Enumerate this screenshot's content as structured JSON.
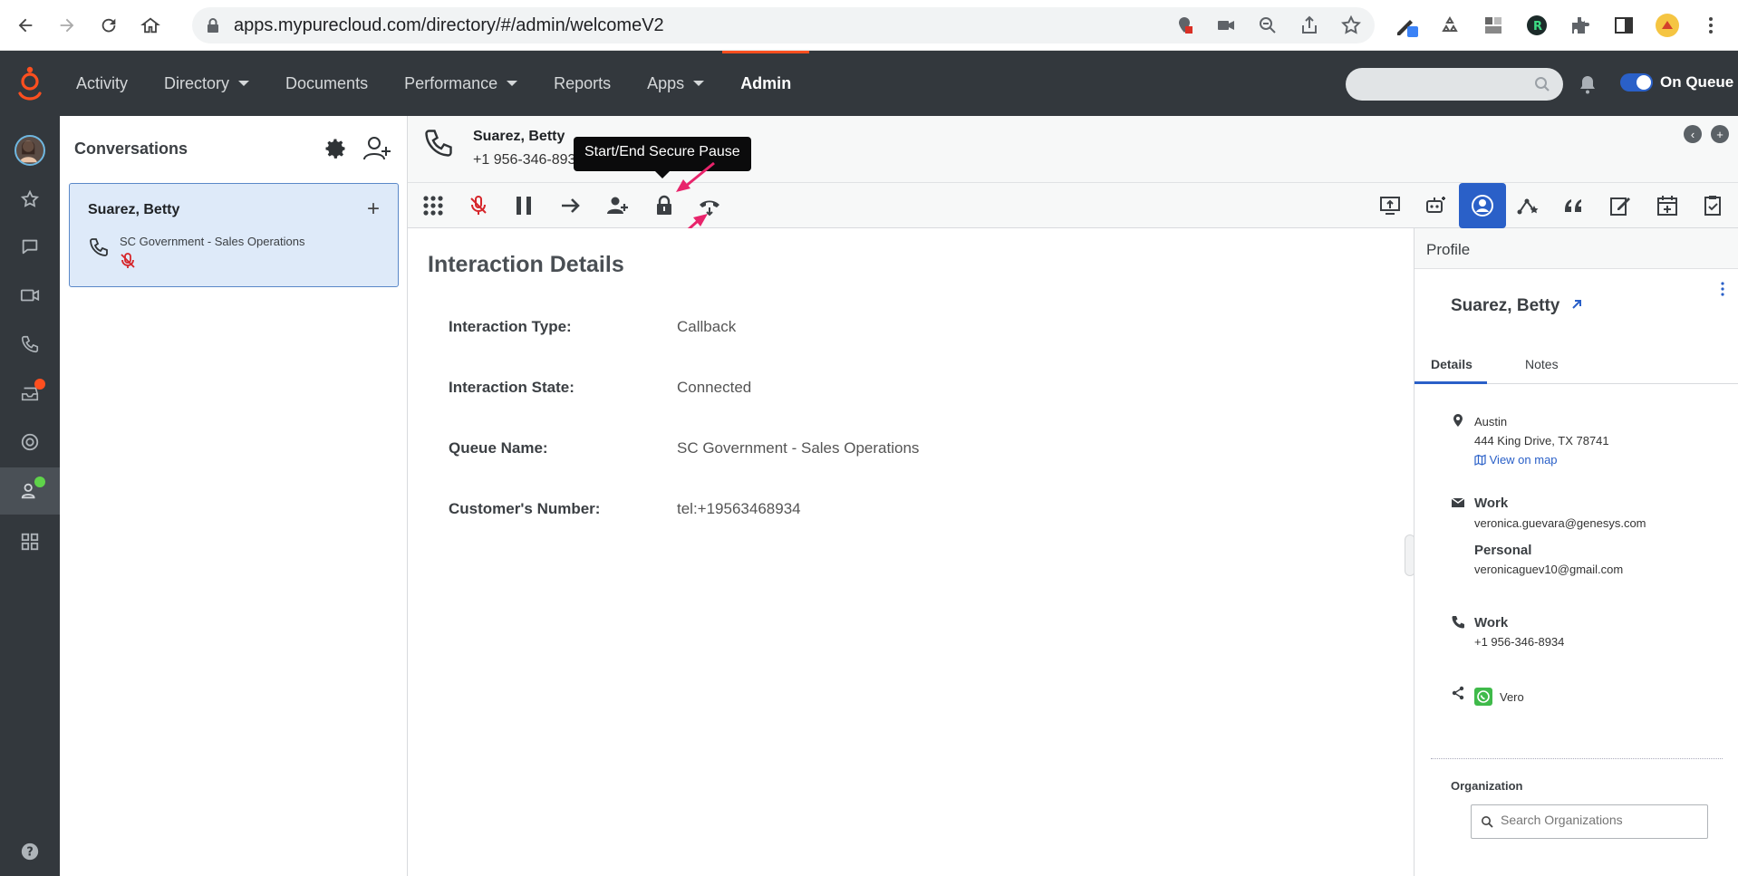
{
  "browser": {
    "url": "apps.mypurecloud.com/directory/#/admin/welcomeV2"
  },
  "nav": {
    "items": [
      {
        "label": "Activity"
      },
      {
        "label": "Directory"
      },
      {
        "label": "Documents"
      },
      {
        "label": "Performance"
      },
      {
        "label": "Reports"
      },
      {
        "label": "Apps"
      },
      {
        "label": "Admin"
      }
    ],
    "status_label": "On Queue"
  },
  "conversations": {
    "title": "Conversations",
    "card": {
      "name": "Suarez, Betty",
      "queue": "SC Government - Sales Operations"
    }
  },
  "call": {
    "name": "Suarez, Betty",
    "number": "+1 956-346-8934"
  },
  "tooltip": {
    "text": "Start/End Secure Pause"
  },
  "details": {
    "heading": "Interaction Details",
    "rows": [
      {
        "label": "Interaction Type:",
        "value": "Callback"
      },
      {
        "label": "Interaction State:",
        "value": "Connected"
      },
      {
        "label": "Queue Name:",
        "value": "SC Government - Sales Operations"
      },
      {
        "label": "Customer's Number:",
        "value": "tel:+19563468934"
      }
    ]
  },
  "profile": {
    "title": "Profile",
    "name": "Suarez, Betty",
    "tabs": [
      "Details",
      "Notes"
    ],
    "address": {
      "city": "Austin",
      "street": "444 King Drive, TX 78741",
      "map_link": "View on map"
    },
    "emails": [
      {
        "type": "Work",
        "value": "veronica.guevara@genesys.com"
      },
      {
        "type": "Personal",
        "value": "veronicaguev10@gmail.com"
      }
    ],
    "phone": {
      "type": "Work",
      "value": "+1 956-346-8934"
    },
    "social": {
      "value": "Vero"
    },
    "organization_label": "Organization",
    "organization_placeholder": "Search Organizations"
  },
  "colors": {
    "brand": "#ff4f1f",
    "nav_bg": "#33383d",
    "accent": "#2a60c8",
    "mute_red": "#d6262b",
    "arrow_pink": "#e8246b"
  }
}
